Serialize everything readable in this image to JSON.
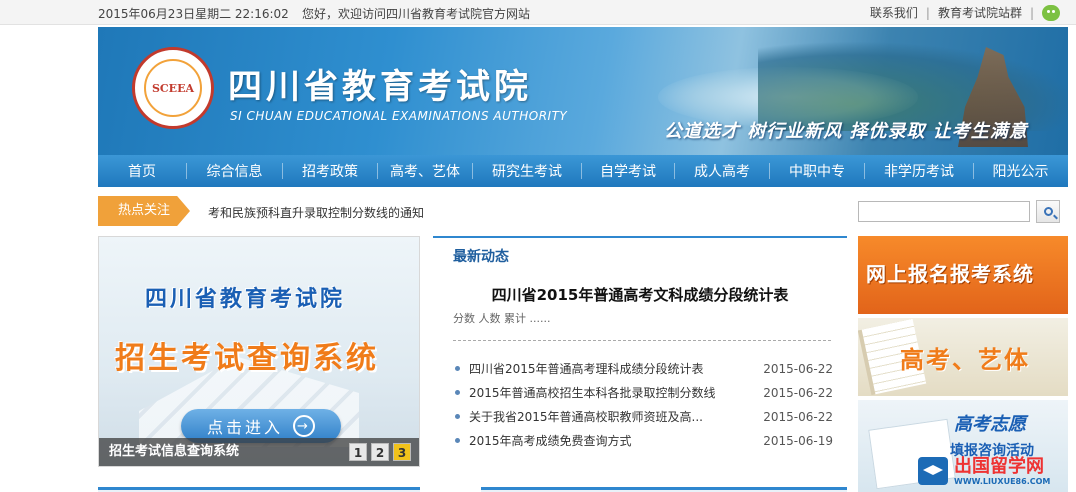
{
  "topbar": {
    "datetime": "2015年06月23日星期二 22:16:02",
    "welcome": "您好，欢迎访问四川省教育考试院官方网站",
    "contact": "联系我们",
    "sitemap": "教育考试院站群",
    "separator": "|"
  },
  "banner": {
    "title": "四川省教育考试院",
    "subtitle_en": "SI CHUAN EDUCATIONAL EXAMINATIONS AUTHORITY",
    "logo_text": "SCEEA",
    "slogan": "公道选才  树行业新风  择优录取  让考生满意"
  },
  "nav": {
    "items": [
      "首页",
      "综合信息",
      "招考政策",
      "高考、艺体",
      "研究生考试",
      "自学考试",
      "成人高考",
      "中职中专",
      "非学历考试",
      "阳光公示"
    ]
  },
  "hotbar": {
    "label": "热点关注",
    "text": "考和民族预科直升录取控制分数线的通知",
    "search_placeholder": ""
  },
  "promo": {
    "title1": "四川省教育考试院",
    "title2": "招生考试查询系统",
    "button": "点击进入",
    "caption": "招生考试信息查询系统",
    "pages": [
      "1",
      "2",
      "3"
    ],
    "active_page": "3"
  },
  "news": {
    "heading": "最新动态",
    "feature_title": "四川省2015年普通高考文科成绩分段统计表",
    "feature_summary": "分数 人数 累计 ......",
    "items": [
      {
        "title": "四川省2015年普通高考理科成绩分段统计表",
        "date": "2015-06-22"
      },
      {
        "title": "2015年普通高校招生本科各批录取控制分数线",
        "date": "2015-06-22"
      },
      {
        "title": "关于我省2015年普通高校职教师资班及高...",
        "date": "2015-06-22"
      },
      {
        "title": "2015年高考成绩免费查询方式",
        "date": "2015-06-19"
      }
    ]
  },
  "side": {
    "card1": "网上报名报考系统",
    "card2": "高考、艺体",
    "card3_title": "高考志愿",
    "card3_sub": "填报咨询活动"
  },
  "watermark": {
    "main": "出国留学网",
    "sub": "WWW.LIUXUE86.COM"
  },
  "colors": {
    "nav_blue": "#1f78bd",
    "hot_orange": "#f0a13a",
    "news_blue": "#2f87cf",
    "promo_orange": "#f07c1a"
  }
}
